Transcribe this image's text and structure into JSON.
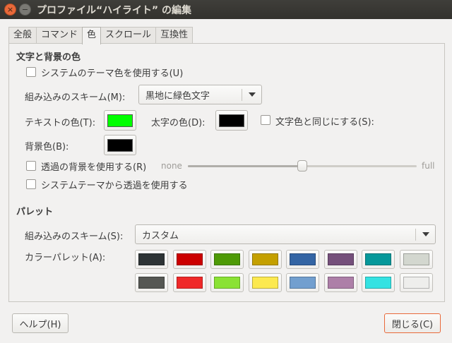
{
  "window": {
    "title": "プロファイル“ハイライト” の編集",
    "close_glyph": "×",
    "min_glyph": "−"
  },
  "tabs": [
    {
      "label": "全般"
    },
    {
      "label": "コマンド"
    },
    {
      "label": "色",
      "active": true
    },
    {
      "label": "スクロール"
    },
    {
      "label": "互換性"
    }
  ],
  "text_bg": {
    "heading": "文字と背景の色",
    "use_system_theme_label": "システムのテーマ色を使用する(U)",
    "scheme_label": "組み込みのスキーム(M):",
    "scheme_value": "黒地に緑色文字",
    "text_color_label": "テキストの色(T):",
    "text_color": "#00ff00",
    "bold_color_label": "太字の色(D):",
    "bold_color": "#000000",
    "same_as_text_label": "文字色と同じにする(S):",
    "bg_color_label": "背景色(B):",
    "bg_color": "#000000",
    "transparent_label": "透過の背景を使用する(R)",
    "slider_min_label": "none",
    "slider_max_label": "full",
    "slider_value": 0.5,
    "system_transparency_label": "システムテーマから透過を使用する"
  },
  "palette": {
    "heading": "パレット",
    "scheme_label": "組み込みのスキーム(S):",
    "scheme_value": "カスタム",
    "palette_label": "カラーパレット(A):",
    "row1": [
      "#2e3436",
      "#cc0000",
      "#4e9a06",
      "#c4a000",
      "#3465a4",
      "#75507b",
      "#06989a",
      "#d3d7cf"
    ],
    "row2": [
      "#555753",
      "#ef2929",
      "#8ae234",
      "#fce94f",
      "#729fcf",
      "#ad7fa8",
      "#34e2e2",
      "#eeeeec"
    ]
  },
  "footer": {
    "help_label": "ヘルプ(H)",
    "close_label": "閉じる(C)"
  }
}
